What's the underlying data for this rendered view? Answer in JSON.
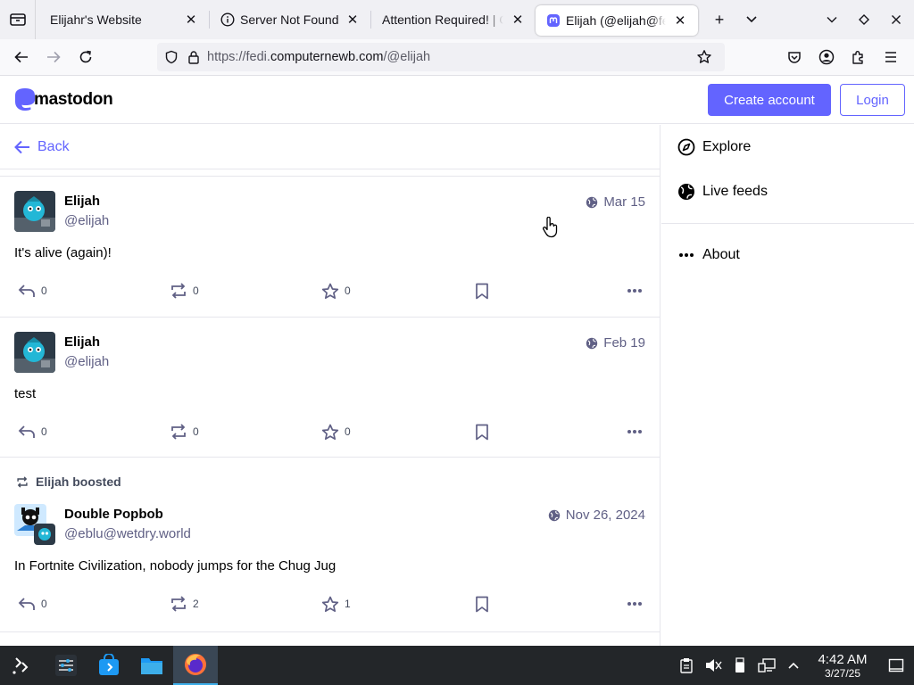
{
  "browser": {
    "tabs": [
      {
        "title": "Elijahr's Website",
        "active": false
      },
      {
        "title": "Server Not Found",
        "active": false
      },
      {
        "title": "Attention Required! | Cl",
        "active": false
      },
      {
        "title": "Elijah (@elijah@fedi",
        "active": true
      }
    ],
    "close_glyph": "✕",
    "new_tab_glyph": "+",
    "url_scheme": "https://fedi.",
    "url_host": "computernewb.com",
    "url_path": "/@elijah"
  },
  "header": {
    "logo_text": "mastodon",
    "create_account_label": "Create account",
    "login_label": "Login"
  },
  "main": {
    "back_label": "Back",
    "statuses": [
      {
        "display_name": "Elijah",
        "acct": "@elijah",
        "time": "Mar 15",
        "content": "It's alive (again)!",
        "replies": "0",
        "boosts": "0",
        "favourites": "0",
        "boosted_by": ""
      },
      {
        "display_name": "Elijah",
        "acct": "@elijah",
        "time": "Feb 19",
        "content": "test",
        "replies": "0",
        "boosts": "0",
        "favourites": "0",
        "boosted_by": ""
      },
      {
        "display_name": "Double Popbob",
        "acct": "@eblu@wetdry.world",
        "time": "Nov 26, 2024",
        "content": "In Fortnite Civilization, nobody jumps for the Chug Jug",
        "replies": "0",
        "boosts": "2",
        "favourites": "1",
        "boosted_by": "Elijah boosted"
      }
    ]
  },
  "sidebar": {
    "items": [
      {
        "label": "Explore",
        "icon": "compass-icon"
      },
      {
        "label": "Live feeds",
        "icon": "globe-icon"
      },
      {
        "label": "About",
        "icon": "more-horizontal-icon"
      }
    ]
  },
  "taskbar": {
    "time": "4:42 AM",
    "date": "3/27/25"
  },
  "colors": {
    "accent": "#6364ff",
    "muted_text": "#606085",
    "taskbar_bg": "#232629"
  }
}
